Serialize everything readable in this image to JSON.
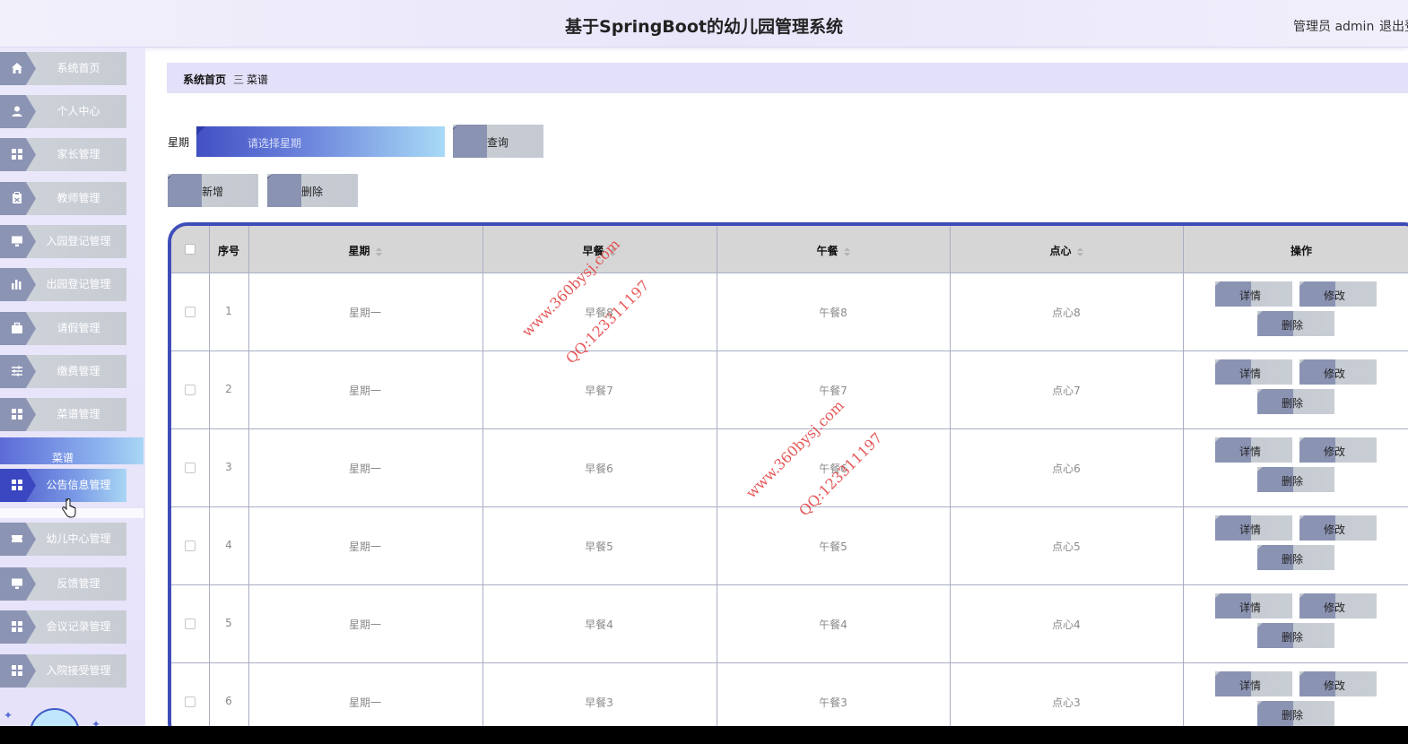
{
  "header": {
    "title": "基于SpringBoot的幼儿园管理系统",
    "user": "管理员 admin",
    "logout": "退出登录"
  },
  "sidebar": {
    "items": [
      {
        "label": "系统首页",
        "icon": "home-icon"
      },
      {
        "label": "个人中心",
        "icon": "user-icon"
      },
      {
        "label": "家长管理",
        "icon": "grid-icon"
      },
      {
        "label": "教师管理",
        "icon": "clipboard-icon"
      },
      {
        "label": "入园登记管理",
        "icon": "monitor-icon"
      },
      {
        "label": "出园登记管理",
        "icon": "bar-chart-icon"
      },
      {
        "label": "请假管理",
        "icon": "briefcase-icon"
      },
      {
        "label": "缴费管理",
        "icon": "sliders-icon"
      },
      {
        "label": "菜谱管理",
        "icon": "grid-icon"
      },
      {
        "label": "公告信息管理",
        "icon": "grid-icon"
      },
      {
        "label": "幼儿中心管理",
        "icon": "ticket-icon"
      },
      {
        "label": "反馈管理",
        "icon": "monitor-icon"
      },
      {
        "label": "会议记录管理",
        "icon": "grid-icon"
      },
      {
        "label": "入院接受管理",
        "icon": "grid-icon"
      }
    ],
    "submenu_label": "菜谱",
    "active_item": "公告信息管理"
  },
  "breadcrumb": {
    "home": "系统首页",
    "separator": "三",
    "current": "菜谱"
  },
  "search": {
    "label": "星期",
    "placeholder": "请选择星期",
    "query_button": "查询"
  },
  "actions": {
    "add": "新增",
    "delete": "删除"
  },
  "table": {
    "columns": [
      "序号",
      "星期",
      "早餐",
      "午餐",
      "点心",
      "操作"
    ],
    "rows": [
      {
        "index": "1",
        "weekday": "星期一",
        "breakfast": "早餐8",
        "lunch": "午餐8",
        "snack": "点心8"
      },
      {
        "index": "2",
        "weekday": "星期一",
        "breakfast": "早餐7",
        "lunch": "午餐7",
        "snack": "点心7"
      },
      {
        "index": "3",
        "weekday": "星期一",
        "breakfast": "早餐6",
        "lunch": "午餐6",
        "snack": "点心6"
      },
      {
        "index": "4",
        "weekday": "星期一",
        "breakfast": "早餐5",
        "lunch": "午餐5",
        "snack": "点心5"
      },
      {
        "index": "5",
        "weekday": "星期一",
        "breakfast": "早餐4",
        "lunch": "午餐4",
        "snack": "点心4"
      },
      {
        "index": "6",
        "weekday": "星期一",
        "breakfast": "早餐3",
        "lunch": "午餐3",
        "snack": "点心3"
      }
    ],
    "row_actions": {
      "detail": "详情",
      "edit": "修改",
      "delete": "删除"
    }
  },
  "watermark": {
    "site": "www.360bysj.com",
    "qq": "QQ:123311197"
  },
  "colors": {
    "accent": "#3f4db8",
    "menu_arrow": "#8c94b4",
    "menu_bg": "#cfd3da",
    "header_bg": "#ebe8fa",
    "watermark": "#e23a3a"
  }
}
